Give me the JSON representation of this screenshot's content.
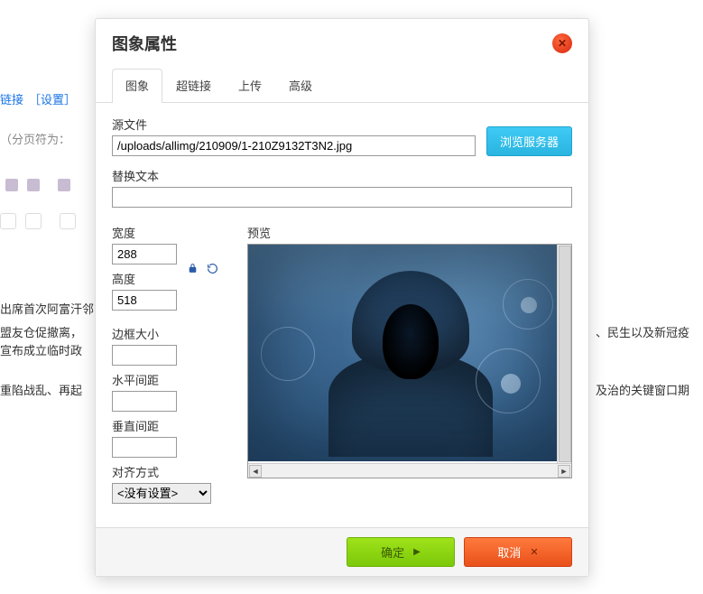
{
  "dialog": {
    "title": "图象属性",
    "tabs": {
      "image": "图象",
      "link": "超链接",
      "upload": "上传",
      "advanced": "高级"
    },
    "labels": {
      "source": "源文件",
      "browse_server": "浏览服务器",
      "alt_text": "替换文本",
      "width": "宽度",
      "height": "高度",
      "border": "边框大小",
      "hspace": "水平间距",
      "vspace": "垂直间距",
      "align": "对齐方式",
      "preview": "预览"
    },
    "values": {
      "source": "/uploads/allimg/210909/1-210Z9132T3N2.jpg",
      "alt_text": "",
      "width": "288",
      "height": "518",
      "border": "",
      "hspace": "",
      "vspace": "",
      "align_selected": "<没有设置>"
    },
    "align_options": [
      "<没有设置>"
    ],
    "buttons": {
      "ok": "确定",
      "cancel": "取消"
    }
  },
  "background": {
    "link_text": "链接",
    "settings_text": "［设置］",
    "paginator_label": "（分页符为：",
    "line1": "出席首次阿富汗邻",
    "line2": "盟友仓促撤离，",
    "line3": "宣布成立临时政",
    "line4": "重陷战乱、再起",
    "right1": "、民生以及新冠疫",
    "right2": "及治的关键窗口期"
  }
}
